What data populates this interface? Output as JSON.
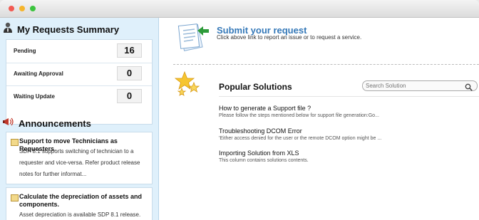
{
  "summary": {
    "title": "My Requests Summary",
    "rows": [
      {
        "label": "Pending",
        "count": "16"
      },
      {
        "label": "Awaiting Approval",
        "count": "0"
      },
      {
        "label": "Waiting Update",
        "count": "0"
      }
    ]
  },
  "announcements": {
    "title": "Announcements",
    "items": [
      {
        "title": "Support to move Technicians as Requesters.",
        "lines": [
          "SDP 8.1 supports switching of technician to a",
          "requester and vice-versa. Refer product release",
          "notes for further informat..."
        ]
      },
      {
        "title_lines": [
          "Calculate the depreciation of assets and",
          "components."
        ],
        "lines": [
          "Asset depreciation is available SDP 8.1 release."
        ]
      }
    ]
  },
  "submit": {
    "title": "Submit your request",
    "subtitle": "Click above link to report an issue or to request a service."
  },
  "popular": {
    "title": "Popular Solutions",
    "search_placeholder": "Search Solution",
    "solutions": [
      {
        "title": "How to generate a Support file ?",
        "desc": "Please follow the steps mentioned below for support file generation:Go..."
      },
      {
        "title": "Troubleshooting DCOM Error",
        "desc": "'Either access denied for the user or the remote DCOM option might be ..."
      },
      {
        "title": "Importing Solution from XLS",
        "desc": "This column contains solutions contents."
      }
    ]
  },
  "icons": {
    "user": "user-icon",
    "megaphone": "megaphone-icon",
    "note": "note-icon",
    "request": "request-form-icon",
    "stars": "stars-icon",
    "search": "search-icon"
  },
  "colors": {
    "accent": "#3478b8",
    "sidebar_bg": "#dff0fb"
  }
}
